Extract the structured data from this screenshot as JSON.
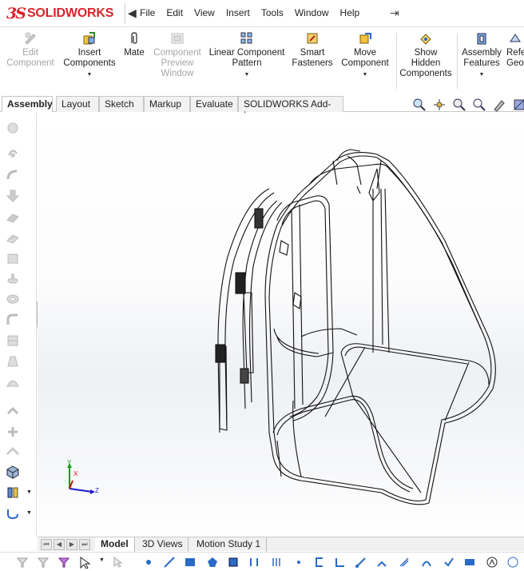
{
  "app": {
    "logo_prefix": "3S",
    "logo_text": "SOLIDWORKS"
  },
  "menu": {
    "items": [
      "File",
      "Edit",
      "View",
      "Insert",
      "Tools",
      "Window",
      "Help"
    ]
  },
  "commands": {
    "edit_component": [
      "Edit",
      "Component"
    ],
    "insert_components": [
      "Insert",
      "Components"
    ],
    "mate": [
      "Mate"
    ],
    "component_preview": [
      "Component",
      "Preview",
      "Window"
    ],
    "linear_pattern": [
      "Linear Component",
      "Pattern"
    ],
    "smart_fasteners": [
      "Smart",
      "Fasteners"
    ],
    "move_component": [
      "Move",
      "Component"
    ],
    "show_hidden": [
      "Show",
      "Hidden",
      "Components"
    ],
    "assembly_features": [
      "Assembly",
      "Features"
    ],
    "reference_geometry": [
      "Refe",
      "Geo"
    ]
  },
  "tabs": [
    "Assembly",
    "Layout",
    "Sketch",
    "Markup",
    "Evaluate",
    "SOLIDWORKS Add-Ins"
  ],
  "active_tab": "Assembly",
  "bottom_tabs": [
    "Model",
    "3D Views",
    "Motion Study 1"
  ],
  "active_bottom_tab": "Model",
  "triad": {
    "y": "Y",
    "x": "X",
    "z": "Z"
  },
  "colors": {
    "brand": "#d8232a",
    "triad_x": "#d01010",
    "triad_y": "#1a9a1a",
    "triad_z": "#1a1acc"
  },
  "icons": {
    "heads_up": [
      "zoom-to-fit-icon",
      "section-view-icon",
      "view-orientation-icon",
      "display-style-icon",
      "hide-show-icon",
      "edit-appearance-icon",
      "apply-scene-icon"
    ],
    "left_toolbar": [
      "line-icon",
      "rotate-icon",
      "fillet-icon",
      "arrow-icon",
      "plane-icon",
      "chamfer-icon",
      "surface-icon",
      "revolve-icon",
      "shell-icon",
      "sweep-icon",
      "rib-icon",
      "loft-icon",
      "dome-icon",
      "wrap-icon",
      "cube-icon",
      "reference-icon",
      "curve-icon"
    ]
  }
}
